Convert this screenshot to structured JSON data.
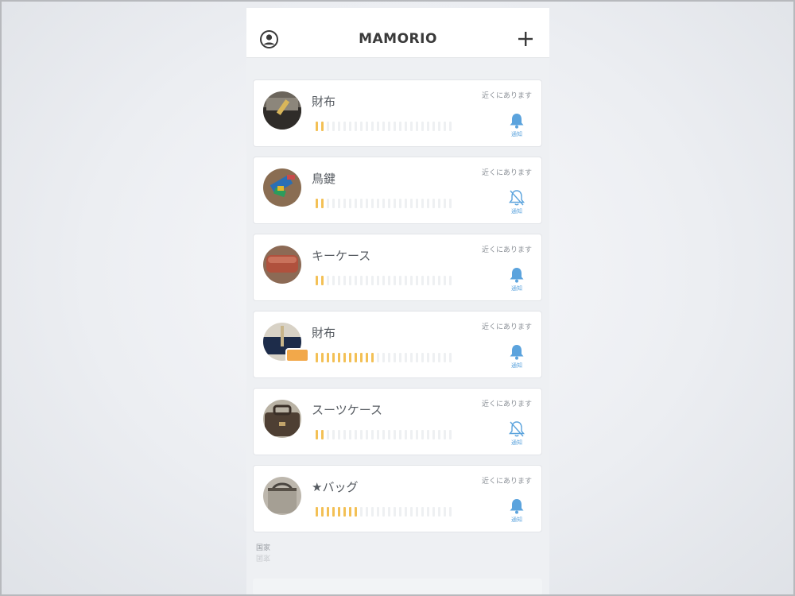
{
  "header": {
    "title": "MAMORIO",
    "account_icon": "account-circle-icon",
    "add_icon": "plus-icon"
  },
  "colors": {
    "meter_on": "#f3c055",
    "meter_off": "#eef0f2",
    "bell": "#5ba3dd",
    "badge": "#f2a84a"
  },
  "meter_total_segments": 25,
  "items": [
    {
      "name": "財布",
      "status": "近くにあります",
      "signal_segments": 2,
      "notify_on": true,
      "notify_label": "通知",
      "thumb": "wallet-dark"
    },
    {
      "name": "鳥鍵",
      "status": "近くにあります",
      "signal_segments": 2,
      "notify_on": false,
      "notify_label": "通知",
      "thumb": "keys-colorful"
    },
    {
      "name": "キーケース",
      "status": "近くにあります",
      "signal_segments": 2,
      "notify_on": true,
      "notify_label": "通知",
      "thumb": "keycase-red"
    },
    {
      "name": "財布",
      "status": "近くにあります",
      "signal_segments": 11,
      "notify_on": true,
      "notify_label": "通知",
      "thumb": "wallet-navy",
      "has_badge": true
    },
    {
      "name": "スーツケース",
      "status": "近くにあります",
      "signal_segments": 2,
      "notify_on": false,
      "notify_label": "通知",
      "thumb": "suitcase-brown"
    },
    {
      "name": "★バッグ",
      "status": "近くにあります",
      "signal_segments": 8,
      "notify_on": true,
      "notify_label": "通知",
      "thumb": "bag-grey"
    }
  ],
  "footer": {
    "text": "国家"
  }
}
